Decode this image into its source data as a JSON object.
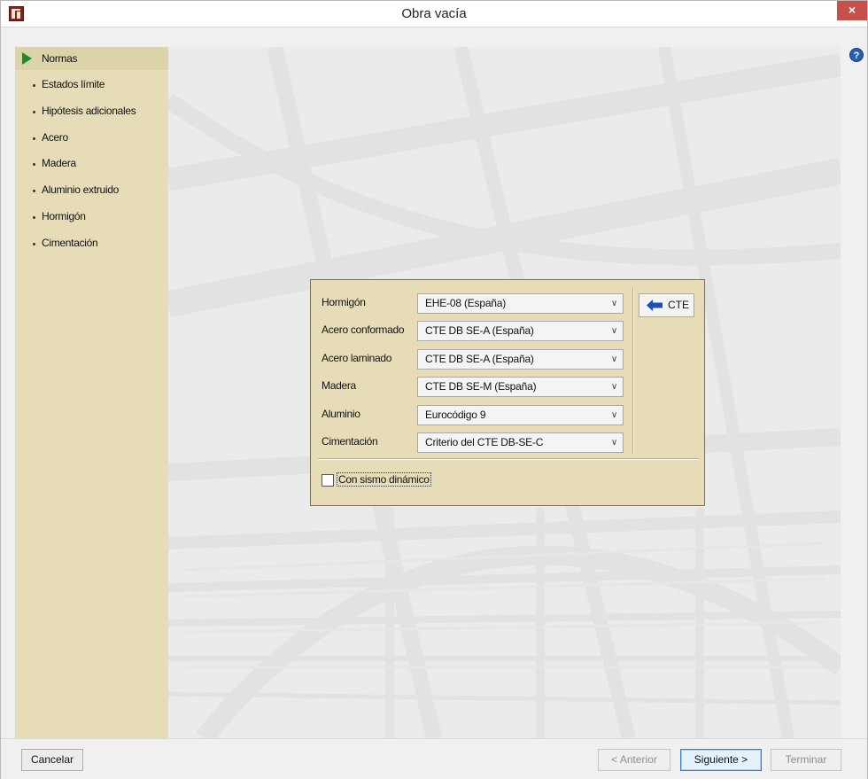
{
  "window": {
    "title": "Obra vacía",
    "close_glyph": "×",
    "help_glyph": "?"
  },
  "sidebar": {
    "items": [
      {
        "label": "Normas",
        "selected": true,
        "icon": "play-icon"
      },
      {
        "label": "Estados límite"
      },
      {
        "label": "Hipótesis adicionales"
      },
      {
        "label": "Acero"
      },
      {
        "label": "Madera"
      },
      {
        "label": "Aluminio extruido"
      },
      {
        "label": "Hormigón"
      },
      {
        "label": "Cimentación"
      }
    ]
  },
  "standards": {
    "rows": [
      {
        "label": "Hormigón",
        "value": "EHE-08 (España)"
      },
      {
        "label": "Acero conformado",
        "value": "CTE DB SE-A (España)"
      },
      {
        "label": "Acero laminado",
        "value": "CTE DB SE-A (España)"
      },
      {
        "label": "Madera",
        "value": "CTE DB SE-M (España)"
      },
      {
        "label": "Aluminio",
        "value": "Eurocódigo 9"
      },
      {
        "label": "Cimentación",
        "value": "Criterio del CTE DB-SE-C"
      }
    ],
    "cte_button": "CTE",
    "seismic_checkbox": {
      "label": "Con sismo dinámico",
      "checked": false
    }
  },
  "footer": {
    "cancel": "Cancelar",
    "previous": "< Anterior",
    "next": "Siguiente >",
    "finish": "Terminar"
  },
  "colors": {
    "panel": "#e6ddb8",
    "accent_green": "#1c8a2a",
    "arrow_blue": "#1f4fb5",
    "close_red": "#c7514a"
  }
}
